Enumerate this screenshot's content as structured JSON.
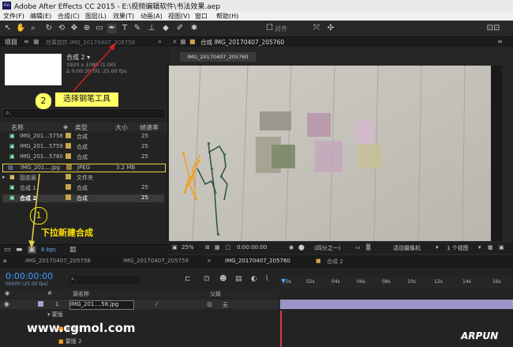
{
  "window": {
    "title": "Adobe After Effects CC 2015 - E:\\视频编辑软件\\书法效果.aep",
    "app_icon": "Ae"
  },
  "menu": [
    "文件(F)",
    "编辑(E)",
    "合成(C)",
    "图层(L)",
    "效果(T)",
    "动画(A)",
    "视图(V)",
    "窗口",
    "帮助(H)"
  ],
  "toolbar": {
    "snap_label": "对齐",
    "icons": [
      "selection-icon",
      "hand-icon",
      "zoom-icon",
      "rotate-icon",
      "camera-orbit-icon",
      "pan-behind-icon",
      "rectangle-icon",
      "pen-icon",
      "type-icon",
      "brush-icon",
      "clone-stamp-icon",
      "eraser-icon",
      "roto-brush-icon",
      "puppet-pin-icon"
    ]
  },
  "project": {
    "tab_label": "项目",
    "effects_tab": "效果控件 IMG_20170407_205758",
    "comp_name": "合成 2 ▾",
    "comp_size": "1920 x 1080 (1.00)",
    "comp_duration": "Δ 0:00:30:00, 25.00 fps",
    "search_icon": "search-icon",
    "columns": [
      "名称",
      "类型",
      "大小",
      "帧速率"
    ],
    "items": [
      {
        "name": "IMG_201...5758",
        "type": "合成",
        "size": "",
        "fps": "25",
        "kind": "comp"
      },
      {
        "name": "IMG_201...5759",
        "type": "合成",
        "size": "",
        "fps": "25",
        "kind": "comp"
      },
      {
        "name": "IMG_201...5760",
        "type": "合成",
        "size": "",
        "fps": "25",
        "kind": "comp"
      },
      {
        "name": "IMG_201....jpg",
        "type": "JPEG",
        "size": "3.2 MB",
        "fps": "",
        "kind": "image"
      },
      {
        "name": "固态层",
        "type": "文件夹",
        "size": "",
        "fps": "",
        "kind": "folder"
      },
      {
        "name": "合成 1",
        "type": "合成",
        "size": "",
        "fps": "25",
        "kind": "comp"
      },
      {
        "name": "合成 2",
        "type": "合成",
        "size": "",
        "fps": "25",
        "kind": "comp"
      }
    ],
    "bpc": "8 bpc"
  },
  "composition": {
    "tab_label": "合成 IMG_20170407_205760",
    "subtab": "IMG_20170407_205760",
    "zoom": "25%",
    "timecode": "0:00:00:00",
    "resolution": "(四分之一)",
    "camera": "活动摄像机",
    "views": "1 个视图"
  },
  "timeline": {
    "tabs": [
      "IMG_20170407_205758",
      "IMG_20170407_205759",
      "IMG_20170407_205760",
      "合成 2"
    ],
    "timecode": "0:00:00:00",
    "fps_note": "00000 (25.00 fps)",
    "col_num": "#",
    "col_name": "源名称",
    "col_parent": "父级",
    "layer_num": "1",
    "layer_name": "IMG_201....58.jpg",
    "parent_value": "无",
    "masks_label": "蒙版",
    "mask1": "蒙版 1",
    "mask2": "蒙版 2",
    "ruler": [
      "0s",
      "02s",
      "04s",
      "06s",
      "08s",
      "10s",
      "12s",
      "14s",
      "16s"
    ]
  },
  "annotations": {
    "step2_num": "2",
    "step2_text": "选择钢笔工具",
    "step1_num": "1",
    "step1_text": "下拉新建合成"
  },
  "watermark": {
    "site": "www.cgmol.com",
    "logo": "ARPUN"
  }
}
